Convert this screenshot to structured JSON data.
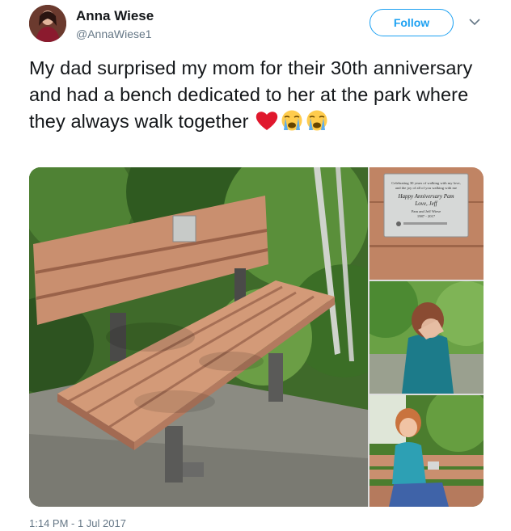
{
  "user": {
    "name": "Anna Wiese",
    "handle": "@AnnaWiese1"
  },
  "follow_label": "Follow",
  "tweet": {
    "text": "My dad surprised my mom for their 30th anniversary and had a bench dedicated to her at the park where they always walk together",
    "emojis": [
      "red-heart",
      "loudly-crying-face",
      "loudly-crying-face"
    ]
  },
  "plaque": {
    "line1": "Celebrating 30 years of walking with my love,",
    "line2": "and the joy of all of you walking with me",
    "line3": "Happy Anniversary Pam",
    "line4": "Love, Jeff",
    "line5": "Pam and Jeff Wiese",
    "line6": "1987 - 2017"
  },
  "timestamp": "1:14 PM - 1 Jul 2017",
  "colors": {
    "accent": "#1da1f2",
    "text": "#14171a",
    "secondary": "#657786"
  }
}
